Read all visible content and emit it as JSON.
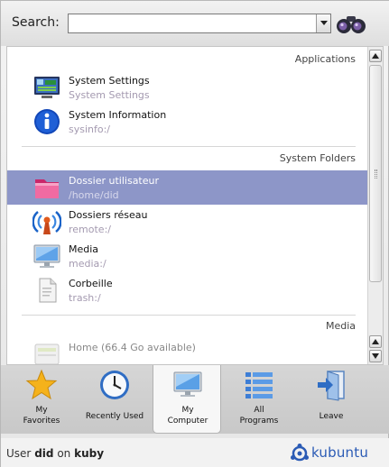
{
  "search": {
    "label": "Search:",
    "value": ""
  },
  "sections": {
    "applications": "Applications",
    "system_folders": "System Folders",
    "media": "Media"
  },
  "items": [
    {
      "title": "System Settings",
      "subtitle": "System Settings",
      "icon": "system-settings-icon"
    },
    {
      "title": "System Information",
      "subtitle": "sysinfo:/",
      "icon": "info-icon"
    },
    {
      "title": "Dossier utilisateur",
      "subtitle": "/home/did",
      "icon": "home-folder-icon",
      "selected": true
    },
    {
      "title": "Dossiers réseau",
      "subtitle": "remote:/",
      "icon": "network-icon"
    },
    {
      "title": "Media",
      "subtitle": "media:/",
      "icon": "monitor-icon"
    },
    {
      "title": "Corbeille",
      "subtitle": "trash:/",
      "icon": "trash-icon"
    },
    {
      "title": "Home (66.4 Go available)",
      "subtitle": "",
      "icon": "drive-icon"
    }
  ],
  "tabs": [
    {
      "label_line1": "My",
      "label_line2": "Favorites",
      "icon": "star-icon"
    },
    {
      "label_line1": "Recently Used",
      "label_line2": "",
      "icon": "clock-icon"
    },
    {
      "label_line1": "My",
      "label_line2": "Computer",
      "icon": "computer-icon",
      "active": true
    },
    {
      "label_line1": "All",
      "label_line2": "Programs",
      "icon": "programs-list-icon"
    },
    {
      "label_line1": "Leave",
      "label_line2": "",
      "icon": "leave-icon"
    }
  ],
  "footer": {
    "prefix": "User",
    "user": "did",
    "on": "on",
    "host": "kuby",
    "brand": "kubuntu"
  },
  "colors": {
    "selection": "#8d96c8",
    "subtitle": "#a49ab0",
    "brand": "#2b5bb5"
  }
}
